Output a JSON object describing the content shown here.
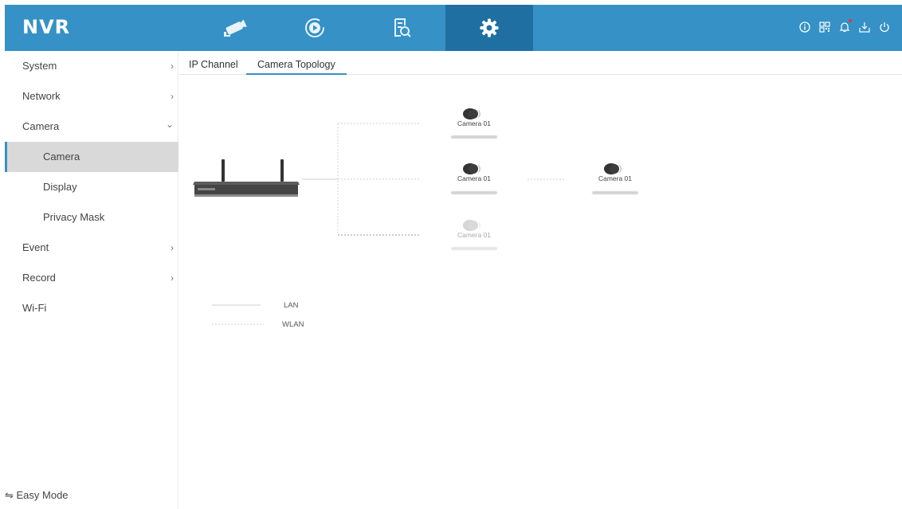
{
  "header": {
    "logo": "NVR",
    "tabs": [
      {
        "name": "live-view",
        "icon": "camera-icon"
      },
      {
        "name": "playback",
        "icon": "playback-icon"
      },
      {
        "name": "search",
        "icon": "search-file-icon"
      },
      {
        "name": "settings",
        "icon": "gear-icon",
        "active": true
      }
    ],
    "right_icons": [
      "info-icon",
      "qr-code-icon",
      "bell-icon",
      "download-icon",
      "power-icon"
    ],
    "accent": "#3591c6",
    "active_tab_color": "#1f6fa3"
  },
  "sidebar": {
    "items": [
      {
        "label": "System",
        "chevron": "›"
      },
      {
        "label": "Network",
        "chevron": "›"
      },
      {
        "label": "Camera",
        "chevron": "⌄"
      },
      {
        "label": "Camera",
        "sub": true,
        "active": true
      },
      {
        "label": "Display",
        "sub": true
      },
      {
        "label": "Privacy Mask",
        "sub": true
      },
      {
        "label": "Event",
        "chevron": "›"
      },
      {
        "label": "Record",
        "chevron": "›"
      },
      {
        "label": "Wi-Fi"
      }
    ],
    "easy_mode": "⇋ Easy Mode"
  },
  "tabs": [
    {
      "label": "IP Channel"
    },
    {
      "label": "Camera Topology",
      "active": true
    }
  ],
  "topology": {
    "cameras": [
      {
        "label": "Camera 01",
        "state": "online"
      },
      {
        "label": "Camera 01",
        "state": "online"
      },
      {
        "label": "Camera 01",
        "state": "offline"
      },
      {
        "label": "Camera 01",
        "state": "online"
      }
    ],
    "legend": [
      {
        "label": "LAN",
        "style": "solid"
      },
      {
        "label": "WLAN",
        "style": "dashed"
      }
    ]
  }
}
